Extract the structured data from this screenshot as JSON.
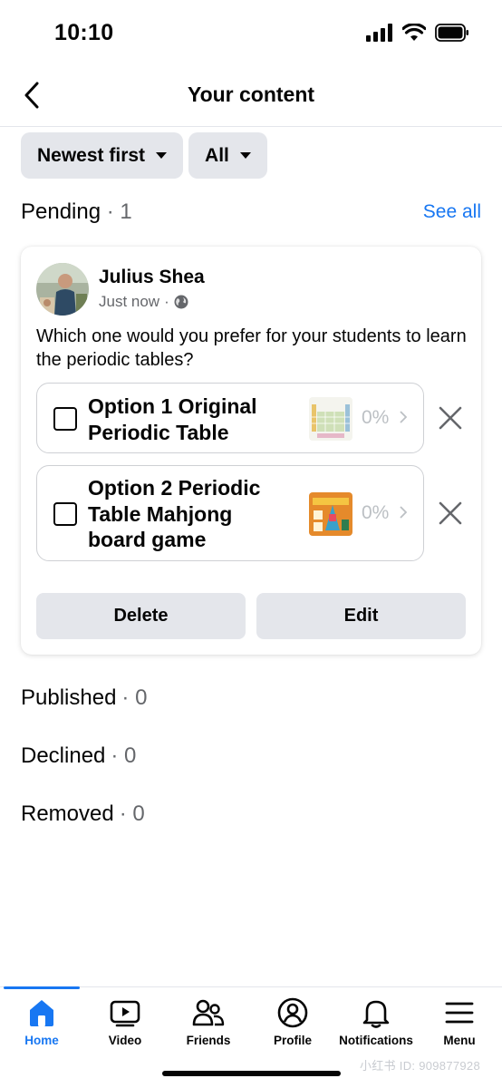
{
  "status_bar": {
    "time": "10:10"
  },
  "header": {
    "title": "Your content"
  },
  "filters": [
    {
      "label": "Newest first"
    },
    {
      "label": "All"
    }
  ],
  "pending": {
    "label": "Pending",
    "count": "· 1",
    "see_all": "See all"
  },
  "post": {
    "author": "Julius Shea",
    "time": "Just now",
    "separator": "·",
    "question": "Which one would you prefer for your students to learn the periodic tables?",
    "options": [
      {
        "label": "Option 1 Original Periodic Table",
        "percent": "0%"
      },
      {
        "label": "Option 2 Periodic Table Mahjong board game",
        "percent": "0%"
      }
    ],
    "delete_label": "Delete",
    "edit_label": "Edit"
  },
  "sections": [
    {
      "label": "Published",
      "count": "· 0"
    },
    {
      "label": "Declined",
      "count": "· 0"
    },
    {
      "label": "Removed",
      "count": "· 0"
    }
  ],
  "tabs": [
    {
      "label": "Home",
      "icon": "home-icon",
      "active": true
    },
    {
      "label": "Video",
      "icon": "video-icon"
    },
    {
      "label": "Friends",
      "icon": "friends-icon"
    },
    {
      "label": "Profile",
      "icon": "profile-icon"
    },
    {
      "label": "Notifications",
      "icon": "bell-icon"
    },
    {
      "label": "Menu",
      "icon": "menu-icon"
    }
  ],
  "watermark": "小红书 ID: 909877928",
  "colors": {
    "accent": "#1877f2",
    "chip_bg": "#e4e6eb",
    "muted": "#65676b"
  }
}
